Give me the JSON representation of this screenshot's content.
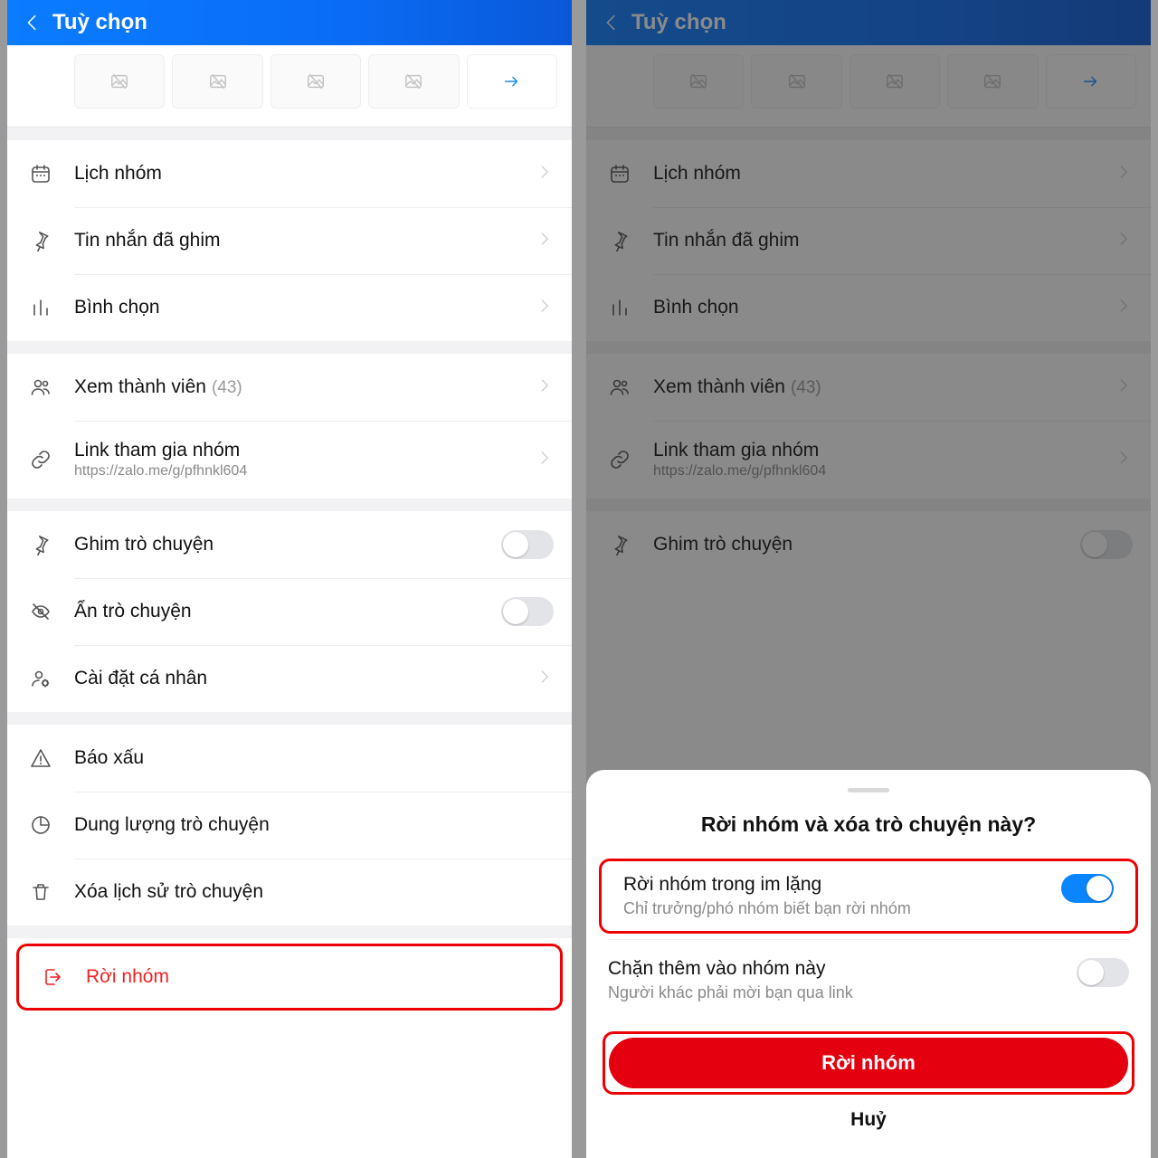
{
  "header": {
    "title": "Tuỳ chọn"
  },
  "rows": {
    "calendar": "Lịch nhóm",
    "pinnedMsg": "Tin nhắn đã ghim",
    "poll": "Bình chọn",
    "members": "Xem thành viên",
    "membersCount": "(43)",
    "link": "Link tham gia nhóm",
    "linkUrl": "https://zalo.me/g/pfhnkl604",
    "pinChat": "Ghim trò chuyện",
    "hideChat": "Ẩn trò chuyện",
    "personal": "Cài đặt cá nhân",
    "report": "Báo xấu",
    "storage": "Dung lượng trò chuyện",
    "clear": "Xóa lịch sử trò chuyện",
    "leave": "Rời nhóm"
  },
  "sheet": {
    "title": "Rời nhóm và xóa trò chuyện này?",
    "opt1": "Rời nhóm trong im lặng",
    "opt1sub": "Chỉ trưởng/phó nhóm biết bạn rời nhóm",
    "opt2": "Chặn thêm vào nhóm này",
    "opt2sub": "Người khác phải mời bạn qua link",
    "leaveBtn": "Rời nhóm",
    "cancel": "Huỷ"
  }
}
